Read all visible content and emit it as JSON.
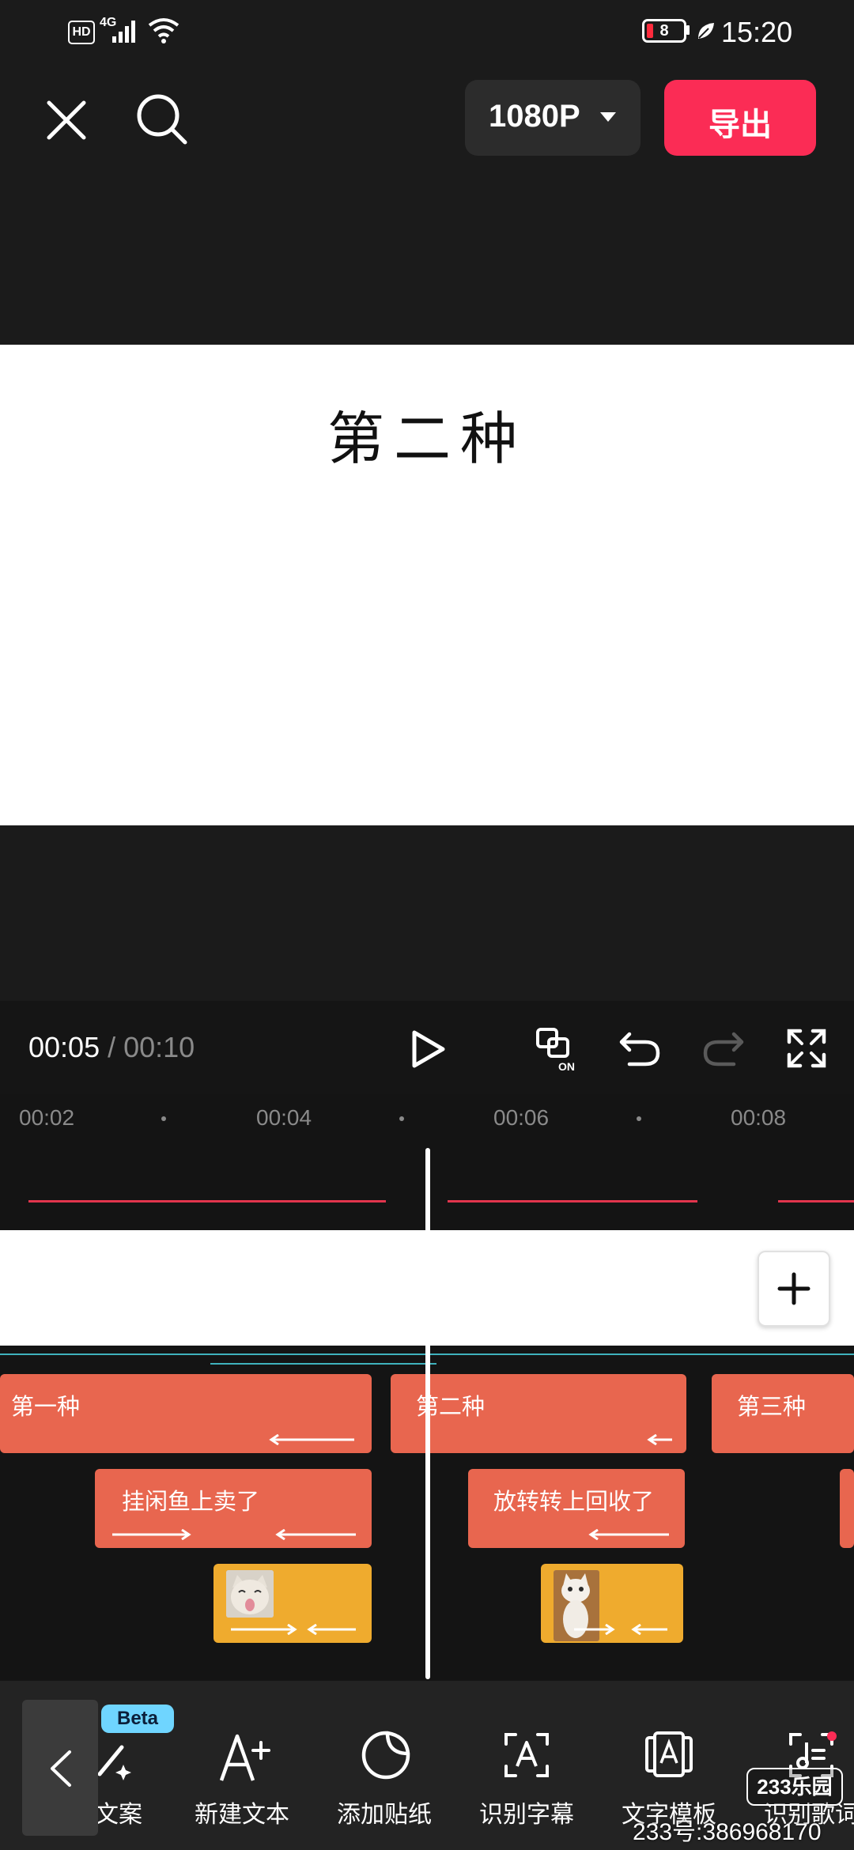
{
  "status_bar": {
    "hd": "HD",
    "network": "4G",
    "battery_level": "8",
    "time": "15:20"
  },
  "top_bar": {
    "resolution": "1080P",
    "export_label": "导出"
  },
  "preview": {
    "canvas_text": "第二种"
  },
  "playback": {
    "current_time": "00:05",
    "separator": " / ",
    "total_time": "00:10"
  },
  "timeline": {
    "ruler_labels": [
      "00:02",
      "00:04",
      "00:06",
      "00:08"
    ],
    "clips_row1": [
      "第一种",
      "第二种",
      "第三种"
    ],
    "clips_row2": [
      "挂闲鱼上卖了",
      "放转转上回收了"
    ]
  },
  "toolbar": {
    "beta_badge": "Beta",
    "items": [
      {
        "label": "文案",
        "icon": "magic-pen-icon"
      },
      {
        "label": "新建文本",
        "icon": "add-text-icon"
      },
      {
        "label": "添加贴纸",
        "icon": "sticker-icon"
      },
      {
        "label": "识别字幕",
        "icon": "caption-recognize-icon"
      },
      {
        "label": "文字模板",
        "icon": "text-template-icon"
      },
      {
        "label": "识别歌词",
        "icon": "lyrics-recognize-icon"
      }
    ]
  },
  "watermark": {
    "logo": "233乐园",
    "text": "233号:386968170"
  },
  "colors": {
    "accent": "#fb2c55",
    "clip_orange": "#e8664f",
    "clip_yellow": "#efab2e",
    "beta": "#6fd5ff"
  }
}
